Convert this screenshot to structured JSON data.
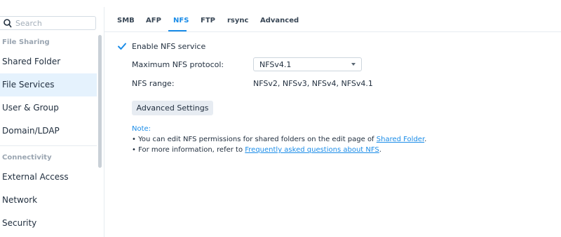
{
  "sidebar": {
    "search_placeholder": "Search",
    "groups": {
      "file_sharing": "File Sharing",
      "connectivity": "Connectivity"
    },
    "items": {
      "shared_folder": "Shared Folder",
      "file_services": "File Services",
      "user_group": "User & Group",
      "domain_ldap": "Domain/LDAP",
      "external_access": "External Access",
      "network": "Network",
      "security": "Security"
    },
    "active_item": "File Services"
  },
  "tabs": {
    "smb": "SMB",
    "afp": "AFP",
    "nfs": "NFS",
    "ftp": "FTP",
    "rsync": "rsync",
    "advanced": "Advanced",
    "active": "NFS"
  },
  "nfs": {
    "enable_label": "Enable NFS service",
    "enabled": true,
    "max_protocol_label": "Maximum NFS protocol:",
    "max_protocol_value": "NFSv4.1",
    "range_label": "NFS range:",
    "range_value": "NFSv2, NFSv3, NFSv4, NFSv4.1",
    "advanced_button": "Advanced Settings"
  },
  "note": {
    "title": "Note:",
    "line1_prefix": "• You can edit NFS permissions for shared folders on the edit page of ",
    "line1_link": "Shared Folder",
    "line1_suffix": ".",
    "line2_prefix": "• For more information, refer to ",
    "line2_link": "Frequently asked questions about NFS",
    "line2_suffix": "."
  },
  "colors": {
    "accent": "#1a8ce8",
    "active_bg": "#e5f2fd",
    "button_bg": "#e7ecf2"
  }
}
